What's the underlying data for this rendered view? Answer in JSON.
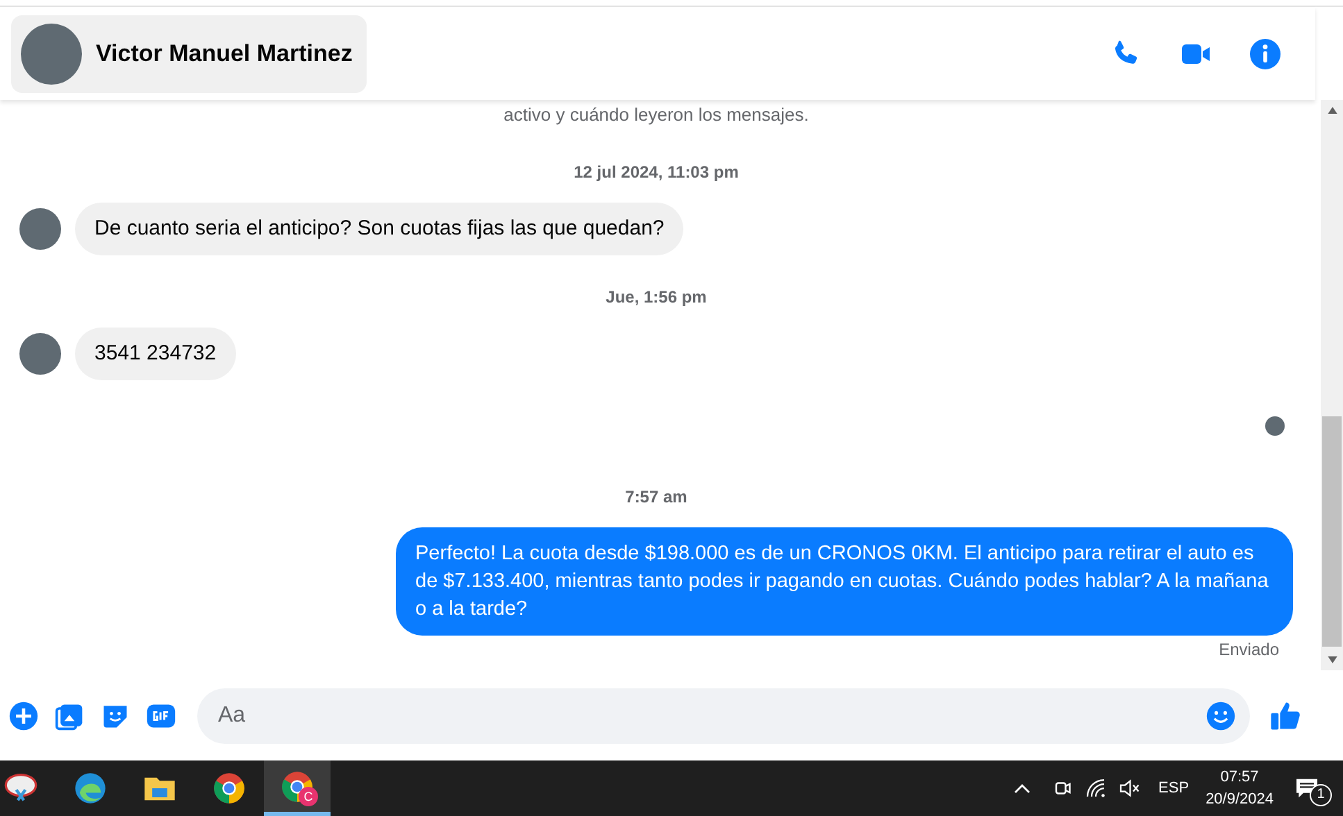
{
  "header": {
    "contact_name": "Victor Manuel Martinez"
  },
  "messages": [
    {
      "kind": "notice",
      "text": "activo y cuándo leyeron los mensajes."
    },
    {
      "kind": "timestamp",
      "text": "12 jul 2024, 11:03 pm"
    },
    {
      "kind": "incoming",
      "text": "De cuanto seria el anticipo? Son cuotas fijas las que quedan?"
    },
    {
      "kind": "timestamp",
      "text": "Jue, 1:56 pm"
    },
    {
      "kind": "incoming",
      "text": "3541 234732"
    },
    {
      "kind": "seen"
    },
    {
      "kind": "timestamp",
      "text": "7:57 am"
    },
    {
      "kind": "outgoing",
      "text": "Perfecto! La cuota desde $198.000 es de un CRONOS 0KM. El anticipo para retirar el auto es de $7.133.400, mientras tanto podes ir pagando en cuotas. Cuándo podes hablar? A la mañana o a la tarde?"
    },
    {
      "kind": "status",
      "text": "Enviado"
    }
  ],
  "composer": {
    "placeholder": "Aa"
  },
  "taskbar": {
    "profile_badge": "C",
    "tray_language": "ESP",
    "time": "07:57",
    "date": "20/9/2024",
    "notification_count": "1"
  }
}
